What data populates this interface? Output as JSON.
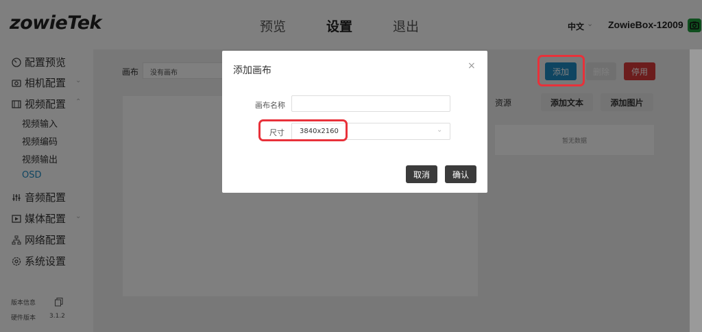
{
  "header": {
    "logo": "zowieTek",
    "nav": [
      "预览",
      "设置",
      "退出"
    ],
    "language": "中文",
    "device_name": "ZowieBox-12009"
  },
  "sidebar": {
    "items": [
      {
        "label": "配置预览"
      },
      {
        "label": "相机配置"
      },
      {
        "label": "视频配置"
      },
      {
        "label": "音频配置"
      },
      {
        "label": "媒体配置"
      },
      {
        "label": "网络配置"
      },
      {
        "label": "系统设置"
      }
    ],
    "video_sub": [
      "视频输入",
      "视频编码",
      "视频输出",
      "OSD"
    ],
    "version_title": "版本信息",
    "hardware_label": "硬件版本",
    "hardware_value": "3.1.2"
  },
  "main": {
    "canvas_label": "画布",
    "canvas_value": "没有画布",
    "add_button": "添加",
    "delete_button": "删除",
    "stop_button": "停用",
    "resource_label": "资源",
    "add_text_button": "添加文本",
    "add_image_button": "添加图片",
    "no_data": "暂无数据"
  },
  "dialog": {
    "title": "添加画布",
    "close": "×",
    "name_label": "画布名称",
    "name_value": "",
    "size_label": "尺寸",
    "size_value": "3840x2160",
    "cancel_button": "取消",
    "confirm_button": "确认"
  },
  "colors": {
    "accent": "#1e8bc3",
    "danger": "#d83a3a",
    "highlight": "#e8313a",
    "dark_button": "#3b3b3b"
  }
}
